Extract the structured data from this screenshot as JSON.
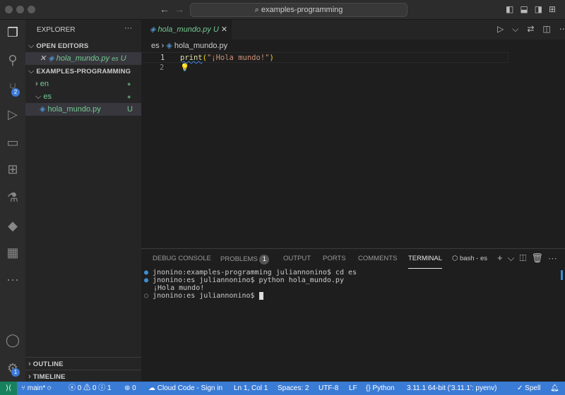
{
  "titlebar": {
    "search": "examples-programming"
  },
  "activity": {
    "source_control_badge": "2",
    "settings_badge": "1"
  },
  "sidebar": {
    "title": "EXPLORER",
    "more": "···",
    "open_editors": {
      "label": "OPEN EDITORS",
      "items": [
        {
          "name": "hola_mundo.py",
          "folder": "es",
          "status": "U"
        }
      ]
    },
    "workspace": {
      "label": "EXAMPLES-PROGRAMMING",
      "items": [
        {
          "name": "en"
        },
        {
          "name": "es"
        },
        {
          "name": "hola_mundo.py",
          "status": "U"
        }
      ]
    },
    "outline": "OUTLINE",
    "timeline": "TIMELINE"
  },
  "editor": {
    "tab": {
      "name": "hola_mundo.py",
      "status": "U"
    },
    "breadcrumb": [
      "es",
      "hola_mundo.py"
    ],
    "lines": [
      {
        "n": "1",
        "fn": "print",
        "open": "(",
        "str": "\"¡Hola mundo!\"",
        "close": ")"
      },
      {
        "n": "2"
      }
    ]
  },
  "panel": {
    "tabs": [
      "DEBUG CONSOLE",
      "PROBLEMS",
      "OUTPUT",
      "PORTS",
      "COMMENTS",
      "TERMINAL"
    ],
    "problems_count": "1",
    "terminal_name": "bash - es",
    "terminal": [
      "jnonino:examples-programming juliannonino$ cd es",
      "jnonino:es juliannonino$ python hola_mundo.py",
      "¡Hola mundo!",
      "jnonino:es juliannonino$ "
    ]
  },
  "status": {
    "branch": "main*",
    "errors": "0",
    "warnings": "0",
    "info": "1",
    "ports": "0",
    "cloud": "Cloud Code - Sign in",
    "position": "Ln 1, Col 1",
    "spaces": "Spaces: 2",
    "encoding": "UTF-8",
    "eol": "LF",
    "language": "Python",
    "interpreter": "3.11.1 64-bit ('3.11.1': pyenv)",
    "spell": "Spell"
  },
  "colors": {
    "accent": "#3a7bd5",
    "untracked": "#73c991",
    "remote": "#16825d"
  }
}
